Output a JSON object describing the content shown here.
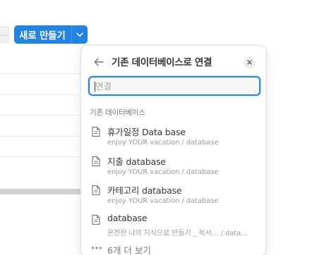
{
  "toolbar": {
    "more_glyph": "…",
    "new_label": "새로 만들기"
  },
  "popover": {
    "title": "기존 데이터베이스로 연결",
    "search_placeholder": "연결",
    "search_value": "",
    "section_label": "기존 데이터베이스",
    "items": [
      {
        "name": "휴가일정 Data base",
        "path": "enjoy YOUR vacation / database",
        "icon": "page-icon"
      },
      {
        "name": "지출 database",
        "path": "enjoy YOUR vacation / database",
        "icon": "page-icon"
      },
      {
        "name": "카테고리 database",
        "path": "enjoy YOUR vacation / database",
        "icon": "page-icon"
      },
      {
        "name": "database",
        "path": "온전한 나의 지식으로 만들기 _ 독서… / data…",
        "icon": "page-icon"
      }
    ],
    "more_label": "6개 더 보기"
  },
  "colors": {
    "accent": "#2383e2",
    "text": "#37352f",
    "muted": "#9b9a97"
  }
}
